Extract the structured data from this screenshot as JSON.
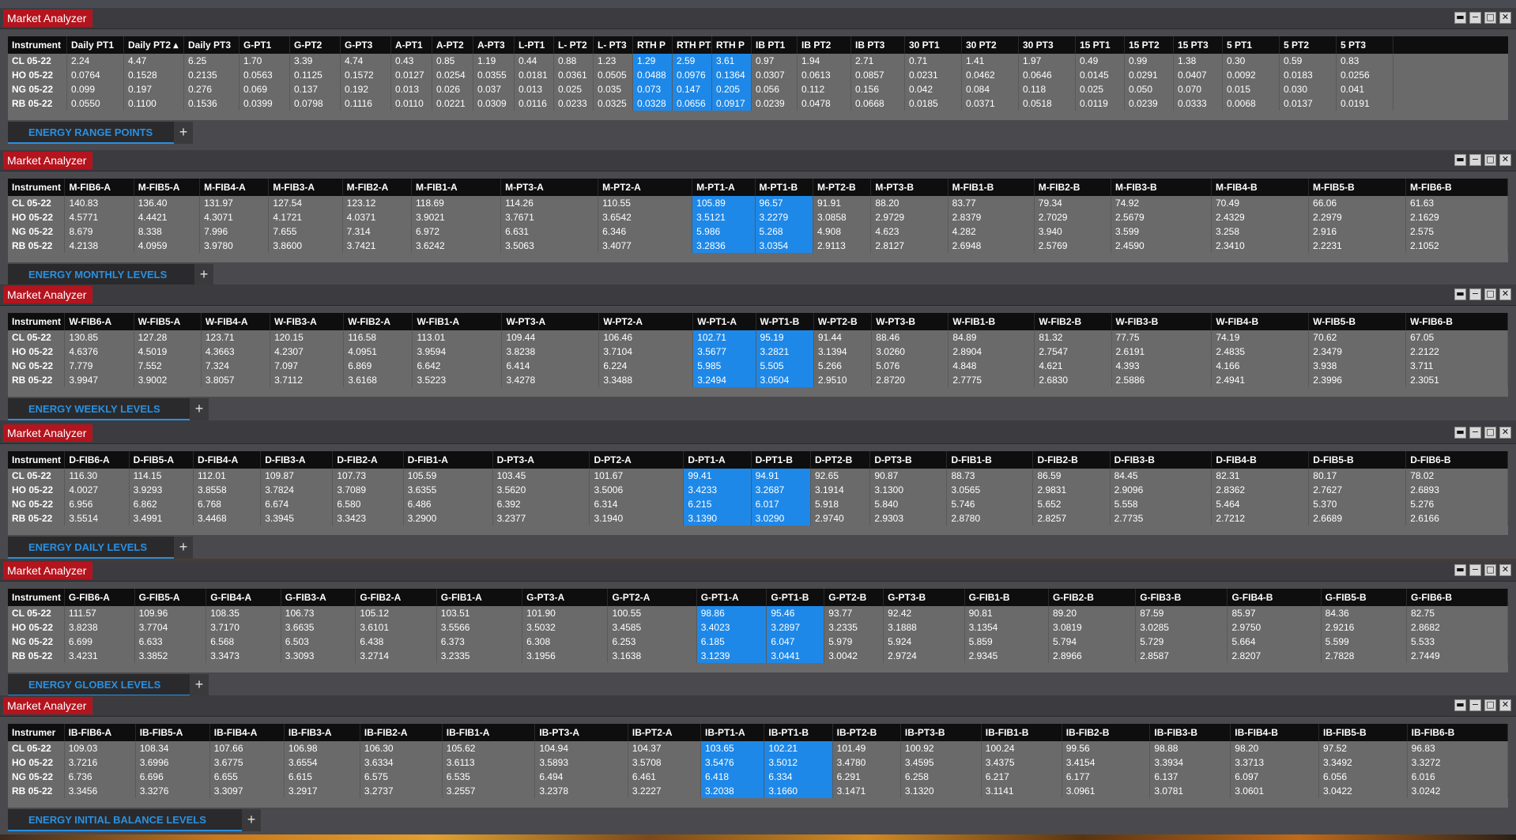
{
  "window_buttons": {
    "dock": "▬",
    "minimize": "−",
    "maximize": "□",
    "close": "✕"
  },
  "panels": [
    {
      "title": "Market Analyzer",
      "tab_label": "ENERGY RANGE POINTS",
      "add_tab": "+",
      "highlight": [
        13,
        14,
        15
      ],
      "columns": [
        "Instrument",
        "Daily PT1",
        "Daily PT2 ▴",
        "Daily PT3",
        "G-PT1",
        "G-PT2",
        "G-PT3",
        "A-PT1",
        "A-PT2",
        "A-PT3",
        "L-PT1",
        "L- PT2",
        "L- PT3",
        "RTH P",
        "RTH PT2",
        "RTH P",
        "IB PT1",
        "IB PT2",
        "IB PT3",
        "30 PT1",
        "30 PT2",
        "30 PT3",
        "15 PT1",
        "15 PT2",
        "15 PT3",
        "5 PT1",
        "5 PT2",
        "5 PT3"
      ],
      "rows": [
        [
          "CL 05-22",
          "2.24",
          "4.47",
          "6.25",
          "1.70",
          "3.39",
          "4.74",
          "0.43",
          "0.85",
          "1.19",
          "0.44",
          "0.88",
          "1.23",
          "1.29",
          "2.59",
          "3.61",
          "0.97",
          "1.94",
          "2.71",
          "0.71",
          "1.41",
          "1.97",
          "0.49",
          "0.99",
          "1.38",
          "0.30",
          "0.59",
          "0.83"
        ],
        [
          "HO 05-22",
          "0.0764",
          "0.1528",
          "0.2135",
          "0.0563",
          "0.1125",
          "0.1572",
          "0.0127",
          "0.0254",
          "0.0355",
          "0.0181",
          "0.0361",
          "0.0505",
          "0.0488",
          "0.0976",
          "0.1364",
          "0.0307",
          "0.0613",
          "0.0857",
          "0.0231",
          "0.0462",
          "0.0646",
          "0.0145",
          "0.0291",
          "0.0407",
          "0.0092",
          "0.0183",
          "0.0256"
        ],
        [
          "NG 05-22",
          "0.099",
          "0.197",
          "0.276",
          "0.069",
          "0.137",
          "0.192",
          "0.013",
          "0.026",
          "0.037",
          "0.013",
          "0.025",
          "0.035",
          "0.073",
          "0.147",
          "0.205",
          "0.056",
          "0.112",
          "0.156",
          "0.042",
          "0.084",
          "0.118",
          "0.025",
          "0.050",
          "0.070",
          "0.015",
          "0.030",
          "0.041"
        ],
        [
          "RB 05-22",
          "0.0550",
          "0.1100",
          "0.1536",
          "0.0399",
          "0.0798",
          "0.1116",
          "0.0110",
          "0.0221",
          "0.0309",
          "0.0116",
          "0.0233",
          "0.0325",
          "0.0328",
          "0.0656",
          "0.0917",
          "0.0239",
          "0.0478",
          "0.0668",
          "0.0185",
          "0.0371",
          "0.0518",
          "0.0119",
          "0.0239",
          "0.0333",
          "0.0068",
          "0.0137",
          "0.0191"
        ]
      ]
    },
    {
      "title": "Market Analyzer",
      "tab_label": "ENERGY MONTHLY LEVELS",
      "add_tab": "+",
      "highlight": [
        9,
        10
      ],
      "columns": [
        "Instrument",
        "M-FIB6-A",
        "M-FIB5-A",
        "M-FIB4-A",
        "M-FIB3-A",
        "M-FIB2-A",
        "M-FIB1-A",
        "M-PT3-A",
        "M-PT2-A",
        "M-PT1-A",
        "M-PT1-B",
        "M-PT2-B",
        "M-PT3-B",
        "M-FIB1-B",
        "M-FIB2-B",
        "M-FIB3-B",
        "M-FIB4-B",
        "M-FIB5-B",
        "M-FIB6-B"
      ],
      "rows": [
        [
          "CL 05-22",
          "140.83",
          "136.40",
          "131.97",
          "127.54",
          "123.12",
          "118.69",
          "114.26",
          "110.55",
          "105.89",
          "96.57",
          "91.91",
          "88.20",
          "83.77",
          "79.34",
          "74.92",
          "70.49",
          "66.06",
          "61.63"
        ],
        [
          "HO 05-22",
          "4.5771",
          "4.4421",
          "4.3071",
          "4.1721",
          "4.0371",
          "3.9021",
          "3.7671",
          "3.6542",
          "3.5121",
          "3.2279",
          "3.0858",
          "2.9729",
          "2.8379",
          "2.7029",
          "2.5679",
          "2.4329",
          "2.2979",
          "2.1629"
        ],
        [
          "NG 05-22",
          "8.679",
          "8.338",
          "7.996",
          "7.655",
          "7.314",
          "6.972",
          "6.631",
          "6.346",
          "5.986",
          "5.268",
          "4.908",
          "4.623",
          "4.282",
          "3.940",
          "3.599",
          "3.258",
          "2.916",
          "2.575"
        ],
        [
          "RB 05-22",
          "4.2138",
          "4.0959",
          "3.9780",
          "3.8600",
          "3.7421",
          "3.6242",
          "3.5063",
          "3.4077",
          "3.2836",
          "3.0354",
          "2.9113",
          "2.8127",
          "2.6948",
          "2.5769",
          "2.4590",
          "2.3410",
          "2.2231",
          "2.1052"
        ]
      ]
    },
    {
      "title": "Market Analyzer",
      "tab_label": "ENERGY WEEKLY LEVELS",
      "add_tab": "+",
      "highlight": [
        9,
        10
      ],
      "columns": [
        "Instrument",
        "W-FIB6-A",
        "W-FIB5-A",
        "W-FIB4-A",
        "W-FIB3-A",
        "W-FIB2-A",
        "W-FIB1-A",
        "W-PT3-A",
        "W-PT2-A",
        "W-PT1-A",
        "W-PT1-B",
        "W-PT2-B",
        "W-PT3-B",
        "W-FIB1-B",
        "W-FIB2-B",
        "W-FIB3-B",
        "W-FIB4-B",
        "W-FIB5-B",
        "W-FIB6-B"
      ],
      "rows": [
        [
          "CL 05-22",
          "130.85",
          "127.28",
          "123.71",
          "120.15",
          "116.58",
          "113.01",
          "109.44",
          "106.46",
          "102.71",
          "95.19",
          "91.44",
          "88.46",
          "84.89",
          "81.32",
          "77.75",
          "74.19",
          "70.62",
          "67.05"
        ],
        [
          "HO 05-22",
          "4.6376",
          "4.5019",
          "4.3663",
          "4.2307",
          "4.0951",
          "3.9594",
          "3.8238",
          "3.7104",
          "3.5677",
          "3.2821",
          "3.1394",
          "3.0260",
          "2.8904",
          "2.7547",
          "2.6191",
          "2.4835",
          "2.3479",
          "2.2122"
        ],
        [
          "NG 05-22",
          "7.779",
          "7.552",
          "7.324",
          "7.097",
          "6.869",
          "6.642",
          "6.414",
          "6.224",
          "5.985",
          "5.505",
          "5.266",
          "5.076",
          "4.848",
          "4.621",
          "4.393",
          "4.166",
          "3.938",
          "3.711"
        ],
        [
          "RB 05-22",
          "3.9947",
          "3.9002",
          "3.8057",
          "3.7112",
          "3.6168",
          "3.5223",
          "3.4278",
          "3.3488",
          "3.2494",
          "3.0504",
          "2.9510",
          "2.8720",
          "2.7775",
          "2.6830",
          "2.5886",
          "2.4941",
          "2.3996",
          "2.3051"
        ]
      ]
    },
    {
      "title": "Market Analyzer",
      "tab_label": "ENERGY DAILY LEVELS",
      "add_tab": "+",
      "highlight": [
        9,
        10
      ],
      "columns": [
        "Instrument",
        "D-FIB6-A",
        "D-FIB5-A",
        "D-FIB4-A",
        "D-FIB3-A",
        "D-FIB2-A",
        "D-FIB1-A",
        "D-PT3-A",
        "D-PT2-A",
        "D-PT1-A",
        "D-PT1-B",
        "D-PT2-B",
        "D-PT3-B",
        "D-FIB1-B",
        "D-FIB2-B",
        "D-FIB3-B",
        "D-FIB4-B",
        "D-FIB5-B",
        "D-FIB6-B"
      ],
      "rows": [
        [
          "CL 05-22",
          "116.30",
          "114.15",
          "112.01",
          "109.87",
          "107.73",
          "105.59",
          "103.45",
          "101.67",
          "99.41",
          "94.91",
          "92.65",
          "90.87",
          "88.73",
          "86.59",
          "84.45",
          "82.31",
          "80.17",
          "78.02"
        ],
        [
          "HO 05-22",
          "4.0027",
          "3.9293",
          "3.8558",
          "3.7824",
          "3.7089",
          "3.6355",
          "3.5620",
          "3.5006",
          "3.4233",
          "3.2687",
          "3.1914",
          "3.1300",
          "3.0565",
          "2.9831",
          "2.9096",
          "2.8362",
          "2.7627",
          "2.6893"
        ],
        [
          "NG 05-22",
          "6.956",
          "6.862",
          "6.768",
          "6.674",
          "6.580",
          "6.486",
          "6.392",
          "6.314",
          "6.215",
          "6.017",
          "5.918",
          "5.840",
          "5.746",
          "5.652",
          "5.558",
          "5.464",
          "5.370",
          "5.276"
        ],
        [
          "RB 05-22",
          "3.5514",
          "3.4991",
          "3.4468",
          "3.3945",
          "3.3423",
          "3.2900",
          "3.2377",
          "3.1940",
          "3.1390",
          "3.0290",
          "2.9740",
          "2.9303",
          "2.8780",
          "2.8257",
          "2.7735",
          "2.7212",
          "2.6689",
          "2.6166"
        ]
      ]
    },
    {
      "title": "Market Analyzer",
      "tab_label": "ENERGY GLOBEX LEVELS",
      "add_tab": "+",
      "highlight": [
        9,
        10
      ],
      "columns": [
        "Instrument",
        "G-FIB6-A",
        "G-FIB5-A",
        "G-FIB4-A",
        "G-FIB3-A",
        "G-FIB2-A",
        "G-FIB1-A",
        "G-PT3-A",
        "G-PT2-A",
        "G-PT1-A",
        "G-PT1-B",
        "G-PT2-B",
        "G-PT3-B",
        "G-FIB1-B",
        "G-FIB2-B",
        "G-FIB3-B",
        "G-FIB4-B",
        "G-FIB5-B",
        "G-FIB6-B"
      ],
      "rows": [
        [
          "CL 05-22",
          "111.57",
          "109.96",
          "108.35",
          "106.73",
          "105.12",
          "103.51",
          "101.90",
          "100.55",
          "98.86",
          "95.46",
          "93.77",
          "92.42",
          "90.81",
          "89.20",
          "87.59",
          "85.97",
          "84.36",
          "82.75"
        ],
        [
          "HO 05-22",
          "3.8238",
          "3.7704",
          "3.7170",
          "3.6635",
          "3.6101",
          "3.5566",
          "3.5032",
          "3.4585",
          "3.4023",
          "3.2897",
          "3.2335",
          "3.1888",
          "3.1354",
          "3.0819",
          "3.0285",
          "2.9750",
          "2.9216",
          "2.8682"
        ],
        [
          "NG 05-22",
          "6.699",
          "6.633",
          "6.568",
          "6.503",
          "6.438",
          "6.373",
          "6.308",
          "6.253",
          "6.185",
          "6.047",
          "5.979",
          "5.924",
          "5.859",
          "5.794",
          "5.729",
          "5.664",
          "5.599",
          "5.533"
        ],
        [
          "RB 05-22",
          "3.4231",
          "3.3852",
          "3.3473",
          "3.3093",
          "3.2714",
          "3.2335",
          "3.1956",
          "3.1638",
          "3.1239",
          "3.0441",
          "3.0042",
          "2.9724",
          "2.9345",
          "2.8966",
          "2.8587",
          "2.8207",
          "2.7828",
          "2.7449"
        ]
      ]
    },
    {
      "title": "Market Analyzer",
      "tab_label": "ENERGY INITIAL BALANCE LEVELS",
      "add_tab": "+",
      "highlight": [
        9,
        10
      ],
      "columns": [
        "Instrumer",
        "IB-FIB6-A",
        "IB-FIB5-A",
        "IB-FIB4-A",
        "IB-FIB3-A",
        "IB-FIB2-A",
        "IB-FIB1-A",
        "IB-PT3-A",
        "IB-PT2-A",
        "IB-PT1-A",
        "IB-PT1-B",
        "IB-PT2-B",
        "IB-PT3-B",
        "IB-FIB1-B",
        "IB-FIB2-B",
        "IB-FIB3-B",
        "IB-FIB4-B",
        "IB-FIB5-B",
        "IB-FIB6-B"
      ],
      "rows": [
        [
          "CL 05-22",
          "109.03",
          "108.34",
          "107.66",
          "106.98",
          "106.30",
          "105.62",
          "104.94",
          "104.37",
          "103.65",
          "102.21",
          "101.49",
          "100.92",
          "100.24",
          "99.56",
          "98.88",
          "98.20",
          "97.52",
          "96.83"
        ],
        [
          "HO 05-22",
          "3.7216",
          "3.6996",
          "3.6775",
          "3.6554",
          "3.6334",
          "3.6113",
          "3.5893",
          "3.5708",
          "3.5476",
          "3.5012",
          "3.4780",
          "3.4595",
          "3.4375",
          "3.4154",
          "3.3934",
          "3.3713",
          "3.3492",
          "3.3272"
        ],
        [
          "NG 05-22",
          "6.736",
          "6.696",
          "6.655",
          "6.615",
          "6.575",
          "6.535",
          "6.494",
          "6.461",
          "6.418",
          "6.334",
          "6.291",
          "6.258",
          "6.217",
          "6.177",
          "6.137",
          "6.097",
          "6.056",
          "6.016"
        ],
        [
          "RB 05-22",
          "3.3456",
          "3.3276",
          "3.3097",
          "3.2917",
          "3.2737",
          "3.2557",
          "3.2378",
          "3.2227",
          "3.2038",
          "3.1660",
          "3.1471",
          "3.1320",
          "3.1141",
          "3.0961",
          "3.0781",
          "3.0601",
          "3.0422",
          "3.0242"
        ]
      ]
    }
  ]
}
